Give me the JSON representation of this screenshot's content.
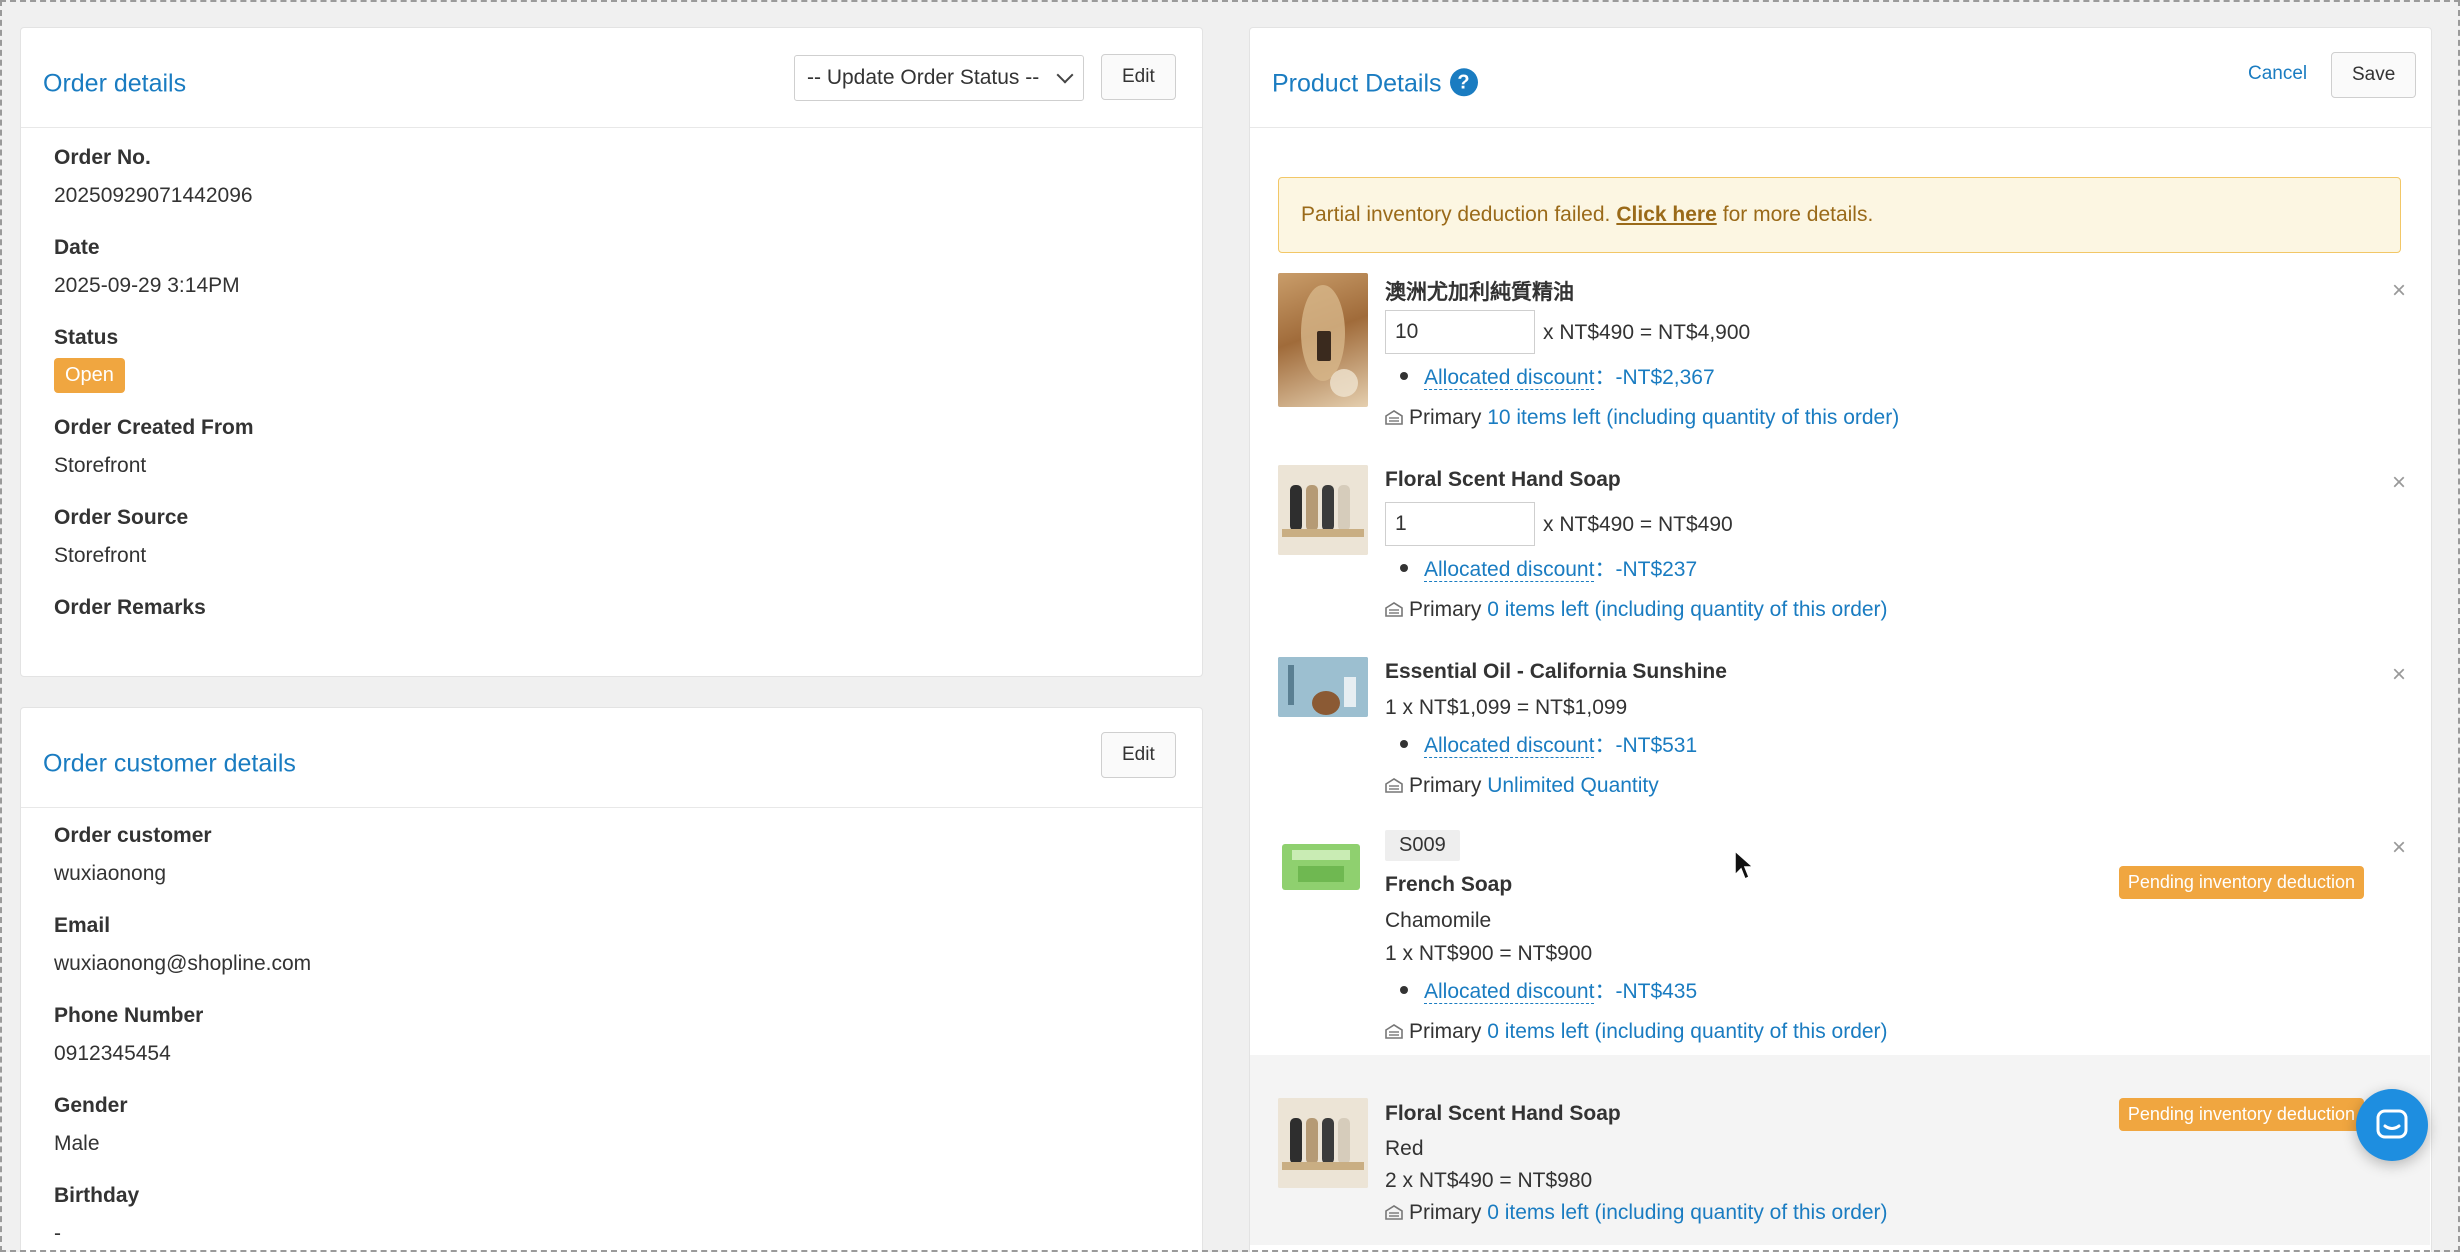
{
  "order_details": {
    "title": "Order details",
    "status_select": "-- Update Order Status --",
    "edit_label": "Edit",
    "fields": {
      "order_no_label": "Order No.",
      "order_no": "20250929071442096",
      "date_label": "Date",
      "date": "2025-09-29 3:14PM",
      "status_label": "Status",
      "status": "Open",
      "created_from_label": "Order Created From",
      "created_from": "Storefront",
      "source_label": "Order Source",
      "source": "Storefront",
      "remarks_label": "Order Remarks"
    }
  },
  "customer_details": {
    "title": "Order customer details",
    "edit_label": "Edit",
    "fields": {
      "customer_label": "Order customer",
      "customer": "wuxiaonong",
      "email_label": "Email",
      "email": "wuxiaonong@shopline.com",
      "phone_label": "Phone Number",
      "phone": "0912345454",
      "gender_label": "Gender",
      "gender": "Male",
      "birthday_label": "Birthday",
      "birthday": "-"
    }
  },
  "product_details": {
    "title": "Product Details",
    "help_icon": "?",
    "cancel_label": "Cancel",
    "save_label": "Save",
    "alert": {
      "before": "Partial inventory deduction failed.",
      "link": "Click here",
      "after": "for more details."
    },
    "items": [
      {
        "name": "澳洲尤加利純質精油",
        "qty": "10",
        "price": "x NT$490 = NT$4,900",
        "discount_label": "Allocated discount",
        "discount": "：-NT$2,367",
        "warehouse": "Primary",
        "stock": "10 items left (including quantity of this order)"
      },
      {
        "name": "Floral Scent Hand Soap",
        "qty": "1",
        "price": "x NT$490 = NT$490",
        "discount_label": "Allocated discount",
        "discount": "：-NT$237",
        "warehouse": "Primary",
        "stock": "0 items left (including quantity of this order)"
      },
      {
        "name": "Essential Oil - California Sunshine",
        "price": "1 x NT$1,099 = NT$1,099",
        "discount_label": "Allocated discount",
        "discount": "：-NT$531",
        "warehouse": "Primary",
        "stock": "Unlimited Quantity"
      },
      {
        "sku": "S009",
        "name": "French Soap",
        "variant": "Chamomile",
        "price": "1 x NT$900 = NT$900",
        "discount_label": "Allocated discount",
        "discount": "：-NT$435",
        "warehouse": "Primary",
        "stock": "0 items left (including quantity of this order)",
        "badge": "Pending inventory deduction"
      },
      {
        "name": "Floral Scent Hand Soap",
        "variant": "Red",
        "price": "2 x NT$490 = NT$980",
        "warehouse": "Primary",
        "stock": "0 items left (including quantity of this order)",
        "badge": "Pending inventory deduction"
      }
    ],
    "remove_icon": "×"
  },
  "colors": {
    "accent": "#1a7cc1",
    "badge_orange": "#f0a640",
    "alert_bg": "#fcf6e2",
    "alert_text": "#9a6a19"
  }
}
